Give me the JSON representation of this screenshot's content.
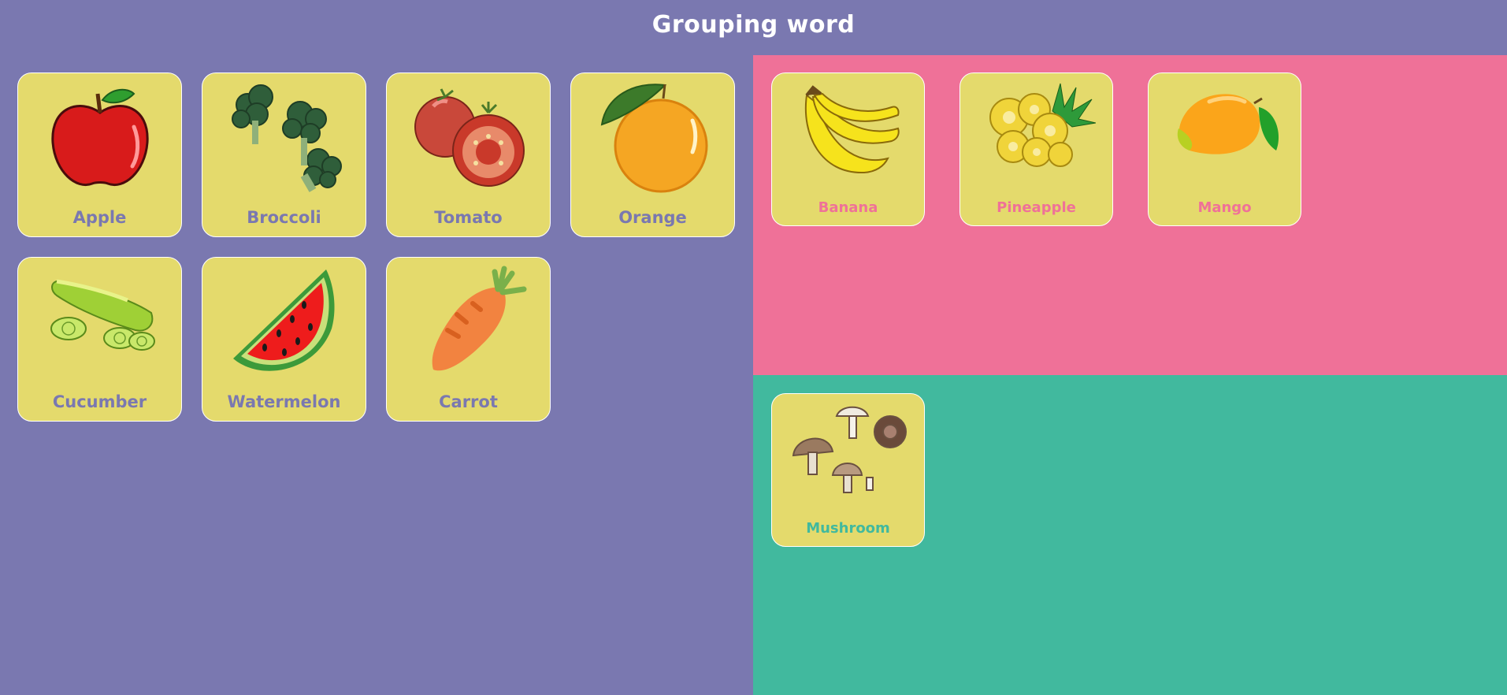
{
  "title": "Grouping word",
  "colors": {
    "background": "#7a78b0",
    "pink_group": "#ef7198",
    "teal_group": "#41b99e",
    "card": "#e4da6c",
    "label_default": "#7a78b0"
  },
  "ungrouped": [
    {
      "label": "Apple",
      "icon": "apple-icon"
    },
    {
      "label": "Broccoli",
      "icon": "broccoli-icon"
    },
    {
      "label": "Tomato",
      "icon": "tomato-icon"
    },
    {
      "label": "Orange",
      "icon": "orange-icon"
    },
    {
      "label": "Cucumber",
      "icon": "cucumber-icon"
    },
    {
      "label": "Watermelon",
      "icon": "watermelon-icon"
    },
    {
      "label": "Carrot",
      "icon": "carrot-icon"
    }
  ],
  "pink_group": [
    {
      "label": "Banana",
      "icon": "banana-icon"
    },
    {
      "label": "Pineapple",
      "icon": "pineapple-icon"
    },
    {
      "label": "Mango",
      "icon": "mango-icon"
    }
  ],
  "teal_group": [
    {
      "label": "Mushroom",
      "icon": "mushroom-icon"
    }
  ]
}
